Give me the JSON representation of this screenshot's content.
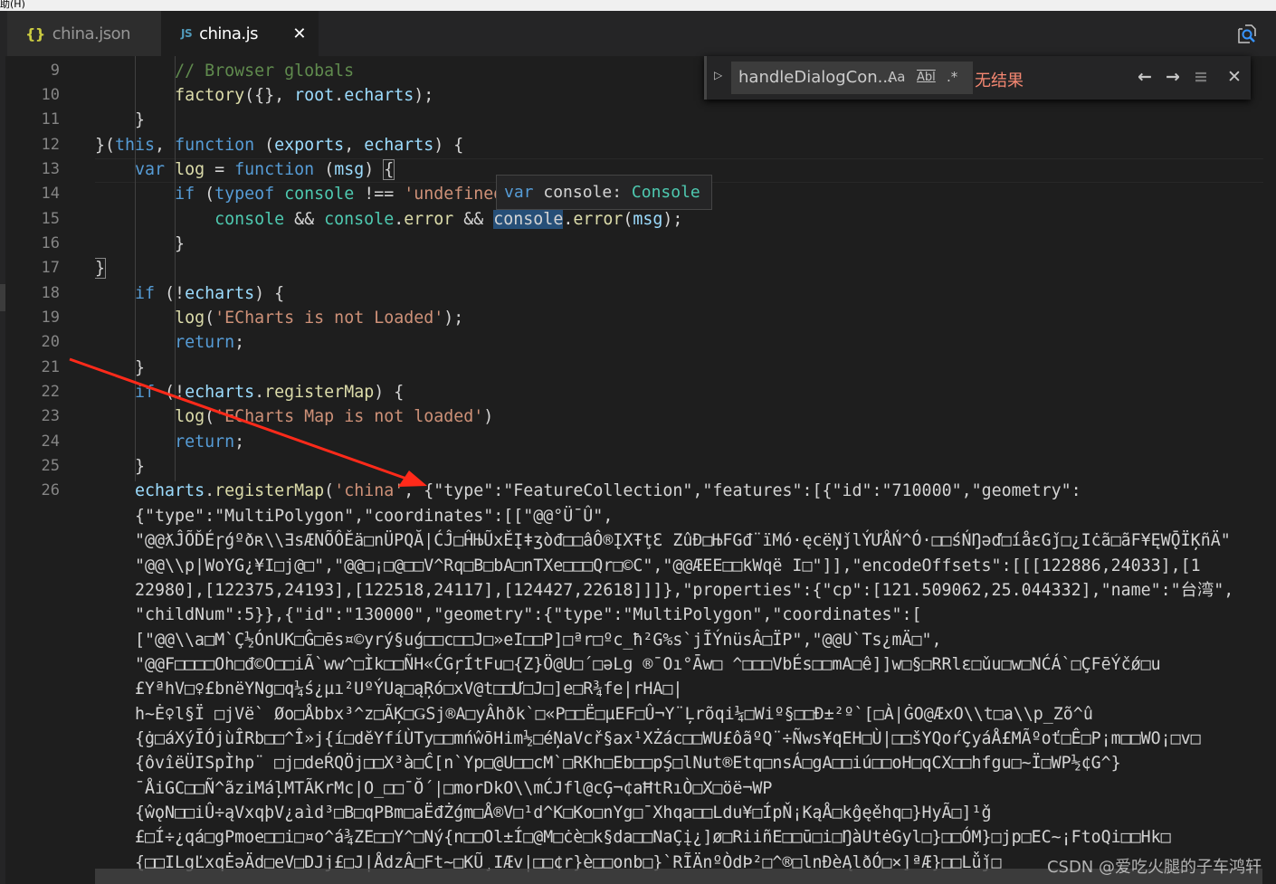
{
  "menubar": {
    "text": "助(H)"
  },
  "tabs": [
    {
      "icon": "{}",
      "label": "china.json",
      "active": false
    },
    {
      "icon": "JS",
      "label": "china.js",
      "active": true,
      "close": "✕"
    }
  ],
  "find_widget": {
    "toggle": "▷",
    "query": "handleDialogCon...",
    "match_case": "Aa",
    "whole_word": "Abl",
    "regex": ".*",
    "result": "无结果",
    "prev": "←",
    "next": "→",
    "selection": "≡",
    "close": "✕"
  },
  "hover_tooltip": {
    "keyword": "var",
    "name": "console",
    "sep": ": ",
    "type": "Console"
  },
  "watermark": "CSDN @爱吃火腿的子车鸿轩",
  "line_numbers": [
    "9",
    "10",
    "11",
    "12",
    "13",
    "14",
    "15",
    "16",
    "17",
    "18",
    "19",
    "20",
    "21",
    "22",
    "23",
    "24",
    "25",
    "26"
  ],
  "code_lines": [
    [
      [
        "def",
        "        "
      ],
      [
        "com",
        "// Browser globals"
      ]
    ],
    [
      [
        "def",
        "        "
      ],
      [
        "fn",
        "factory"
      ],
      [
        "def",
        "({}, "
      ],
      [
        "var",
        "root"
      ],
      [
        "def",
        "."
      ],
      [
        "var",
        "echarts"
      ],
      [
        "def",
        ");"
      ]
    ],
    [
      [
        "def",
        "    }"
      ]
    ],
    [
      [
        "def",
        "}("
      ],
      [
        "kw",
        "this"
      ],
      [
        "def",
        ", "
      ],
      [
        "kw",
        "function"
      ],
      [
        "def",
        " ("
      ],
      [
        "var",
        "exports"
      ],
      [
        "def",
        ", "
      ],
      [
        "var",
        "echarts"
      ],
      [
        "def",
        ") {"
      ]
    ],
    [
      [
        "def",
        "    "
      ],
      [
        "kw",
        "var"
      ],
      [
        "def",
        " "
      ],
      [
        "fn",
        "log"
      ],
      [
        "def",
        " = "
      ],
      [
        "kw",
        "function"
      ],
      [
        "def",
        " ("
      ],
      [
        "var",
        "msg"
      ],
      [
        "def",
        ") "
      ],
      [
        "br",
        "{"
      ]
    ],
    [
      [
        "def",
        "        "
      ],
      [
        "kw",
        "if"
      ],
      [
        "def",
        " ("
      ],
      [
        "kw",
        "typeof"
      ],
      [
        "def",
        " "
      ],
      [
        "type",
        "console"
      ],
      [
        "def",
        " !== "
      ],
      [
        "str",
        "'undefined'"
      ]
    ],
    [
      [
        "def",
        "            "
      ],
      [
        "type",
        "console"
      ],
      [
        "def",
        " && "
      ],
      [
        "type",
        "console"
      ],
      [
        "def",
        "."
      ],
      [
        "fn",
        "error"
      ],
      [
        "def",
        " && "
      ],
      [
        "hl",
        "console"
      ],
      [
        "def",
        "."
      ],
      [
        "fn",
        "error"
      ],
      [
        "def",
        "("
      ],
      [
        "var",
        "msg"
      ],
      [
        "def",
        ");"
      ]
    ],
    [
      [
        "def",
        "        }"
      ]
    ],
    [
      [
        "br",
        "}"
      ]
    ],
    [
      [
        "def",
        "    "
      ],
      [
        "kw",
        "if"
      ],
      [
        "def",
        " (!"
      ],
      [
        "var",
        "echarts"
      ],
      [
        "def",
        ") {"
      ]
    ],
    [
      [
        "def",
        "        "
      ],
      [
        "fn",
        "log"
      ],
      [
        "def",
        "("
      ],
      [
        "str",
        "'ECharts is not Loaded'"
      ],
      [
        "def",
        ");"
      ]
    ],
    [
      [
        "def",
        "        "
      ],
      [
        "kw",
        "return"
      ],
      [
        "def",
        ";"
      ]
    ],
    [
      [
        "def",
        "    }"
      ]
    ],
    [
      [
        "def",
        "    "
      ],
      [
        "kw",
        "if"
      ],
      [
        "def",
        " (!"
      ],
      [
        "var",
        "echarts"
      ],
      [
        "def",
        "."
      ],
      [
        "fn",
        "registerMap"
      ],
      [
        "def",
        ") {"
      ]
    ],
    [
      [
        "def",
        "        "
      ],
      [
        "fn",
        "log"
      ],
      [
        "def",
        "("
      ],
      [
        "str",
        "'ECharts Map is not loaded'"
      ],
      [
        "def",
        ")"
      ]
    ],
    [
      [
        "def",
        "        "
      ],
      [
        "kw",
        "return"
      ],
      [
        "def",
        ";"
      ]
    ],
    [
      [
        "def",
        "    }"
      ]
    ],
    [
      [
        "def",
        "    "
      ],
      [
        "var",
        "echarts"
      ],
      [
        "def",
        "."
      ],
      [
        "fn",
        "registerMap"
      ],
      [
        "def",
        "("
      ],
      [
        "str",
        "'china'"
      ],
      [
        "def",
        ", {\"type\":\"FeatureCollection\",\"features\":[{\"id\":\"710000\",\"geometry\":"
      ]
    ],
    [
      [
        "def",
        "    {\"type\":\"MultiPolygon\",\"coordinates\":[[\"@@°Ü¯Û\","
      ]
    ],
    [
      [
        "def",
        "    \"@@ƛĴÕĎÉɼǵºðʀ\\\\∃sÆNÕÔĚä□nÜPQĂ|ĆĴ□ĤЊŨxĚĮǂʒòđ□□âÔ®ĮXŦţƐ ZûĐ□ЊFGđ¨ïMó·ęcëŅǰlÝƯÅŃ^Ó·□□śŃŊǝď□íåɛGǰ□¿Iċã□ãF¥ĘWǬÏĶñÄ\""
      ]
    ],
    [
      [
        "def",
        "    \"@@\\\\p|WoYG¿¥I□j@□\",\"@@□¡□@□□V^Rq□B□bA□nTXe□□□Qr□©C\",\"@@ÆEE□□kWqë I□\"]],\"encodeOffsets\":[[[122886,24033],[1"
      ]
    ],
    [
      [
        "def",
        "    22980],[122375,24193],[122518,24117],[124427,22618]]]},\"properties\":{\"cp\":[121.509062,25.044332],\"name\":\"台湾\","
      ]
    ],
    [
      [
        "def",
        "    \"childNum\":5}},{\"id\":\"130000\",\"geometry\":{\"type\":\"MultiPolygon\",\"coordinates\":["
      ]
    ],
    [
      [
        "def",
        "    [\"@@\\\\a□M`Ç½ÓnUK□Ĝ□ēs¤©yrý§uǵ□□c□□J□»eI□□P]□ªr□ºc_ħ²G%s`jĨÝnüsÂ□ÏP\",\"@@U`Ts¿mÄ□\","
      ]
    ],
    [
      [
        "def",
        "    \"@@F□□□□Oh□đ©O□□iÃ`ww^□Ìk□□ÑH«ĆGŗÍtFu□{Z}Ö@U□´□əLg ®¯Oı°Āw□ ^□□□VbÉs□□mA□ê]]w□§□RRlɛ□ǔu□w□NĆÁ`□ÇFēÝčǿ□u"
      ]
    ],
    [
      [
        "def",
        "    £YªhV□♀£bnëYNg□q¼ś¿µı²UºÝUą□ąŖó□xV@t□□Ư□J□]e□R¾fe|rHA□|"
      ]
    ],
    [
      [
        "def",
        "    h~Ė♀l§Ï □jVë` Øo□Åbbx³^z□ÃĶ□ǤSj®A□yÂhðk`□«P□□Ë□µEF□Û¬Y¨Ļrõqi¼□Wiº§□□Ð±²º`[□À|ĠO@ÆxO\\\\t□a\\\\p_Zõ^û"
      ]
    ],
    [
      [
        "def",
        "    {ġ□áXýĪÓjùÎRb□□^Î»j{í□dĕYfíÙTy□□mńŵōHim½□éŅaVcř§ax¹XŻác□□WU£ôãºQ¨÷Ñws¥qEH□Ù|□□šYQoŕÇyáÅ£MÃºoť□Ê□P¡m□□WO¡□v□"
      ]
    ],
    [
      [
        "def",
        "    {ôvîëÜISpÌhp¨ □j□deŔQÖj□□X³à□Ĉ[n`Yp□@U□□cM`□RKh□Eb□□pŞ□lNut®Etq□nsÁ□gA□□iú□□oH□qCX□□hfgu□~Ï□WP½¢G^}"
      ]
    ],
    [
      [
        "def",
        "    ¯ÅiGC□□Ñ^ãziMáļMTÃKrMc|O_□□¯Ŏ´|□morDkO\\\\mĆJfl@cĢ¬¢aĦtRıÒ□X□öë¬WP"
      ]
    ],
    [
      [
        "def",
        "    {ŵǫN□□iÛ÷ąVxqþV¿aìd³□B□qPBm□aËđŻǵm□Å®V□¹d^K□Ko□nYg□¯Xhqa□□Ldu¥□ÍpŇ¡KąÅ□kĝęěhq□}HyÃ□]¹ǧ"
      ]
    ],
    [
      [
        "def",
        "    £□Í÷¿qá□gPmoe□□i□¤o^á¾ZE□□Y^□Ný{n□□Ol±Í□@M□ċè□k§da□□NaÇį¿]ø□RiiñE□□ū□i□ŊàUtėGyl□}□□ÓM}□jp□EC~¡FtoQi□□Hk□"
      ]
    ],
    [
      [
        "def",
        "    {□□ILgĽxqĖǝÄd□eV□DJj£□J|ÅdzÂ□Ft~□KŨ¸IÆv|□□¢r}è□□onb□}`RĨÄnºÒdÞ²□^®□lnĐèĄlðÓ□×]ªÆ}□□Lǚǰ□"
      ]
    ]
  ],
  "colors": {
    "comment": "#608b4e",
    "keyword": "#569cd6",
    "function": "#dcdcaa",
    "variable": "#9cdcfe",
    "string": "#ce9178",
    "type": "#4ec9b0",
    "text": "#d4d4d4",
    "find_no_result": "#f48771",
    "annotation_arrow": "#ff2a1a"
  }
}
